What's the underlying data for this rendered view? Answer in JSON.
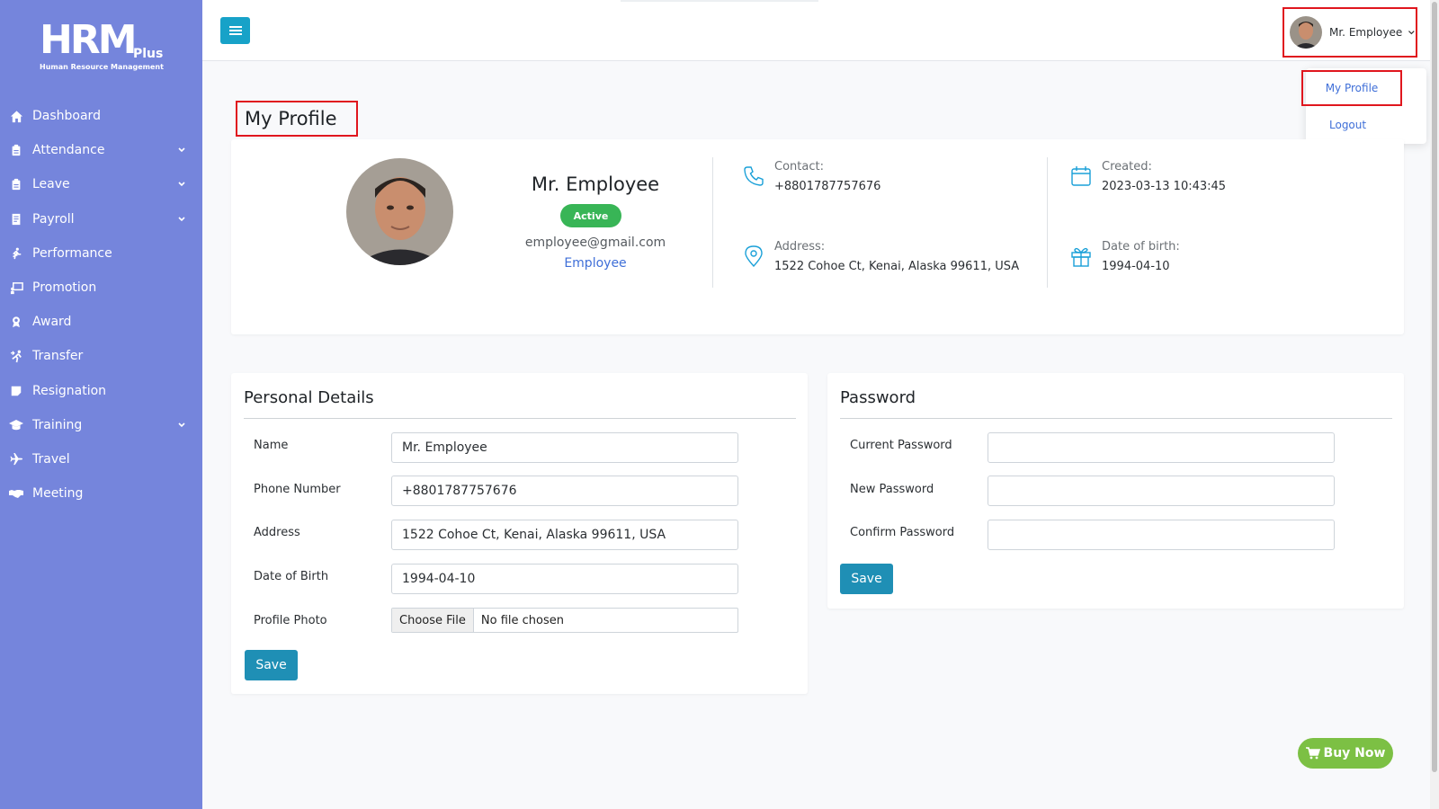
{
  "brand": {
    "logo_main": "HRM",
    "logo_plus": "Plus",
    "logo_sub": "Human Resource Management"
  },
  "sidebar": {
    "items": [
      {
        "label": "Dashboard",
        "icon": "home-icon",
        "expandable": false
      },
      {
        "label": "Attendance",
        "icon": "clipboard-icon",
        "expandable": true
      },
      {
        "label": "Leave",
        "icon": "clipboard-icon",
        "expandable": true
      },
      {
        "label": "Payroll",
        "icon": "receipt-icon",
        "expandable": true
      },
      {
        "label": "Performance",
        "icon": "running-icon",
        "expandable": false
      },
      {
        "label": "Promotion",
        "icon": "presentation-icon",
        "expandable": false
      },
      {
        "label": "Award",
        "icon": "award-icon",
        "expandable": false
      },
      {
        "label": "Transfer",
        "icon": "transfer-icon",
        "expandable": false
      },
      {
        "label": "Resignation",
        "icon": "note-icon",
        "expandable": false
      },
      {
        "label": "Training",
        "icon": "graduation-cap-icon",
        "expandable": true
      },
      {
        "label": "Travel",
        "icon": "plane-icon",
        "expandable": false
      },
      {
        "label": "Meeting",
        "icon": "handshake-icon",
        "expandable": false
      }
    ]
  },
  "topbar": {
    "user_name": "Mr. Employee"
  },
  "dropdown": {
    "my_profile": "My Profile",
    "logout": "Logout"
  },
  "page": {
    "title": "My Profile"
  },
  "profile": {
    "name": "Mr. Employee",
    "status": "Active",
    "email": "employee@gmail.com",
    "role": "Employee",
    "contact_label": "Contact:",
    "contact": "+8801787757676",
    "address_label": "Address:",
    "address": "1522 Cohoe Ct, Kenai, Alaska 99611, USA",
    "created_label": "Created:",
    "created": "2023-03-13 10:43:45",
    "dob_label": "Date of birth:",
    "dob": "1994-04-10"
  },
  "personal": {
    "title": "Personal Details",
    "name_label": "Name",
    "name_value": "Mr. Employee",
    "phone_label": "Phone Number",
    "phone_value": "+8801787757676",
    "address_label": "Address",
    "address_value": "1522 Cohoe Ct, Kenai, Alaska 99611, USA",
    "dob_label": "Date of Birth",
    "dob_value": "1994-04-10",
    "photo_label": "Profile Photo",
    "choose_file": "Choose File",
    "no_file": "No file chosen",
    "save": "Save"
  },
  "password": {
    "title": "Password",
    "current_label": "Current Password",
    "new_label": "New Password",
    "confirm_label": "Confirm Password",
    "save": "Save"
  },
  "buy_now": "Buy Now",
  "colors": {
    "sidebar": "#7585dc",
    "accent": "#17a2c8",
    "active_badge": "#38b556",
    "buy_now": "#7cc044",
    "highlight": "#e0161e"
  }
}
